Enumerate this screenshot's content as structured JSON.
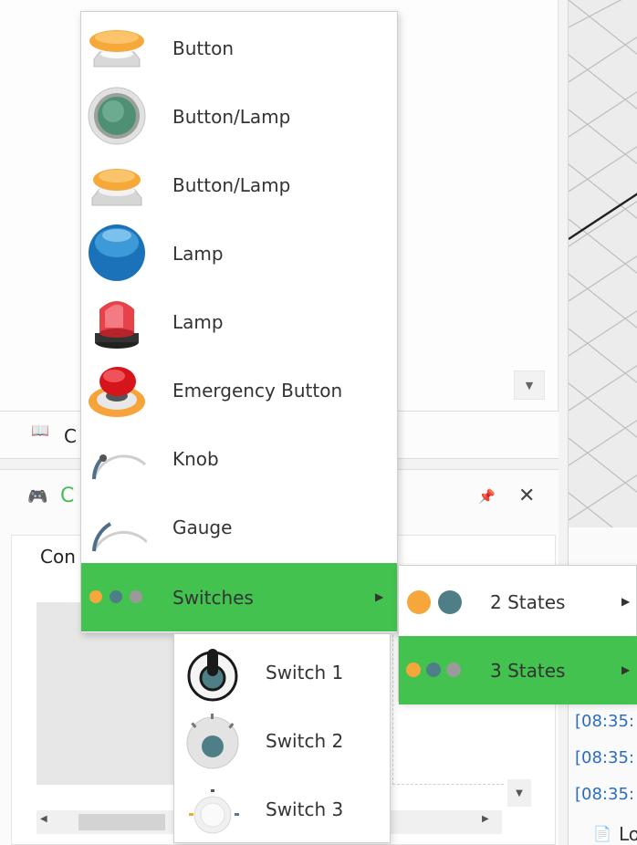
{
  "main_menu": {
    "items": [
      {
        "label": "Button",
        "icon": "orange-push-button-icon"
      },
      {
        "label": "Button/Lamp",
        "icon": "green-button-lamp-icon"
      },
      {
        "label": "Button/Lamp",
        "icon": "orange-button-lamp-icon"
      },
      {
        "label": "Lamp",
        "icon": "blue-lamp-icon"
      },
      {
        "label": "Lamp",
        "icon": "red-beacon-lamp-icon"
      },
      {
        "label": "Emergency Button",
        "icon": "emergency-button-icon"
      },
      {
        "label": "Knob",
        "icon": "knob-icon"
      },
      {
        "label": "Gauge",
        "icon": "gauge-icon"
      },
      {
        "label": "Switches",
        "icon": "three-dots-switch-icon",
        "active": true
      }
    ]
  },
  "switches_submenu": {
    "items": [
      {
        "label": "2 States",
        "icon": "two-dots-icon"
      },
      {
        "label": "3 States",
        "icon": "three-dots-icon",
        "active": true
      }
    ]
  },
  "three_states_panel": {
    "items": [
      {
        "label": "Switch 1",
        "icon": "toggle-lever-switch-icon"
      },
      {
        "label": "Switch 2",
        "icon": "rotary-selector-switch-icon"
      },
      {
        "label": "Switch 3",
        "icon": "rotary-knob-switch-icon"
      }
    ]
  },
  "background": {
    "tab_letter": "C",
    "panel_letter": "C",
    "inner_title": "Con",
    "log_lines": [
      "[08:35:",
      "[08:35:",
      "[08:35:"
    ],
    "log_tab_letter": "Lo"
  },
  "colors": {
    "highlight": "#43c24f",
    "orange": "#f5a73b",
    "teal": "#4e7f87",
    "grey": "#9a9a9a",
    "log_text": "#2b6cc0"
  }
}
